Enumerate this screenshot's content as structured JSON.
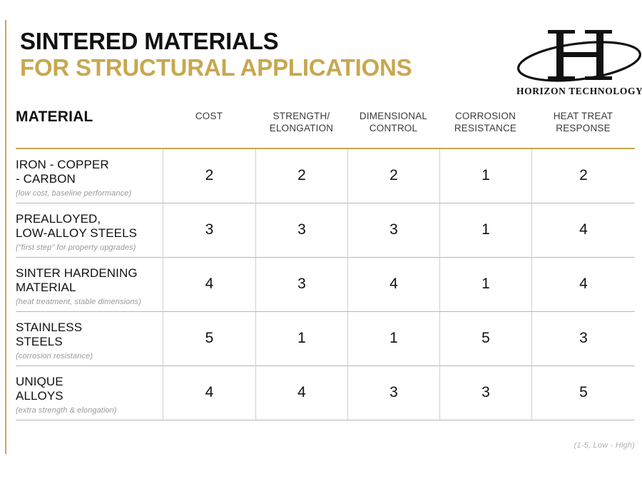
{
  "accent_color": "#C8A750",
  "title": {
    "line1": "SINTERED MATERIALS",
    "line2": "FOR STRUCTURAL APPLICATIONS"
  },
  "logo": {
    "mark": "H",
    "wordmark": "HORIZON TECHNOLOGY"
  },
  "table": {
    "material_header": "MATERIAL",
    "columns": [
      "COST",
      "STRENGTH/\nELONGATION",
      "DIMENSIONAL\nCONTROL",
      "CORROSION\nRESISTANCE",
      "HEAT TREAT\nRESPONSE"
    ],
    "rows": [
      {
        "name": "IRON - COPPER\n- CARBON",
        "note": "(low cost, baseline performance)",
        "values": [
          "2",
          "2",
          "2",
          "1",
          "2"
        ]
      },
      {
        "name": "PREALLOYED,\nLOW-ALLOY STEELS",
        "note": "(\"first step\" for property upgrades)",
        "values": [
          "3",
          "3",
          "3",
          "1",
          "4"
        ]
      },
      {
        "name": "SINTER HARDENING\nMATERIAL",
        "note": "(heat treatment, stable dimensions)",
        "values": [
          "4",
          "3",
          "4",
          "1",
          "4"
        ]
      },
      {
        "name": "STAINLESS\nSTEELS",
        "note": "(corrosion resistance)",
        "values": [
          "5",
          "1",
          "1",
          "5",
          "3"
        ]
      },
      {
        "name": "UNIQUE\nALLOYS",
        "note": "(extra strength & elongation)",
        "values": [
          "4",
          "4",
          "3",
          "3",
          "5"
        ]
      }
    ]
  },
  "footnote": "(1-5, Low - High)",
  "chart_data": {
    "type": "table",
    "title": "SINTERED MATERIALS FOR STRUCTURAL APPLICATIONS",
    "categories": [
      "COST",
      "STRENGTH/ELONGATION",
      "DIMENSIONAL CONTROL",
      "CORROSION RESISTANCE",
      "HEAT TREAT RESPONSE"
    ],
    "series": [
      {
        "name": "IRON - COPPER - CARBON",
        "values": [
          2,
          2,
          2,
          1,
          2
        ]
      },
      {
        "name": "PREALLOYED, LOW-ALLOY STEELS",
        "values": [
          3,
          3,
          3,
          1,
          4
        ]
      },
      {
        "name": "SINTER HARDENING MATERIAL",
        "values": [
          4,
          3,
          4,
          1,
          4
        ]
      },
      {
        "name": "STAINLESS STEELS",
        "values": [
          5,
          1,
          1,
          5,
          3
        ]
      },
      {
        "name": "UNIQUE ALLOYS",
        "values": [
          4,
          4,
          3,
          3,
          5
        ]
      }
    ],
    "xlabel": "",
    "ylabel": "",
    "ylim": [
      1,
      5
    ],
    "annotation": "(1-5, Low - High)"
  }
}
